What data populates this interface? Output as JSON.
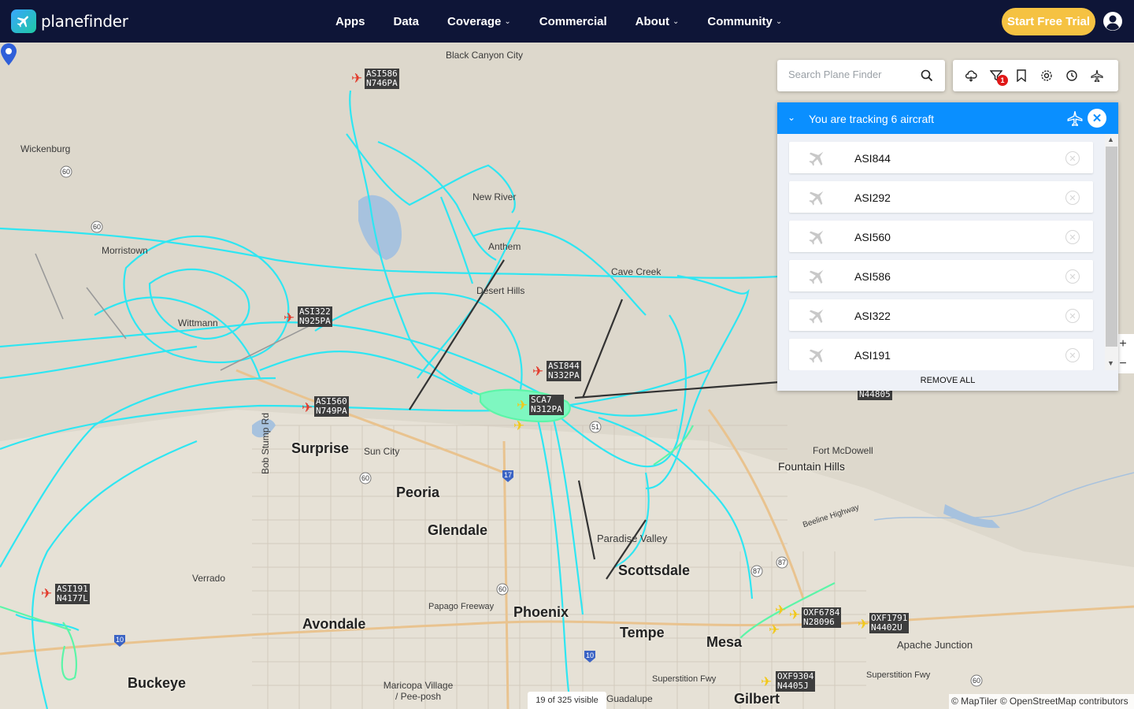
{
  "brand": {
    "name": "planefinder"
  },
  "nav": {
    "items": [
      {
        "label": "Apps",
        "dropdown": false
      },
      {
        "label": "Data",
        "dropdown": false
      },
      {
        "label": "Coverage",
        "dropdown": true
      },
      {
        "label": "Commercial",
        "dropdown": false
      },
      {
        "label": "About",
        "dropdown": true
      },
      {
        "label": "Community",
        "dropdown": true
      }
    ],
    "cta_label": "Start Free Trial"
  },
  "search": {
    "placeholder": "Search Plane Finder"
  },
  "toolbar": {
    "icons": [
      "cloud-icon",
      "filter-icon",
      "bookmark-icon",
      "settings-icon",
      "history-icon",
      "aircraft-settings-icon"
    ],
    "filter_badge": "1"
  },
  "tracking": {
    "title": "You are tracking 6 aircraft",
    "aircraft": [
      "ASI844",
      "ASI292",
      "ASI560",
      "ASI586",
      "ASI322",
      "ASI191"
    ],
    "remove_all_label": "REMOVE ALL"
  },
  "map": {
    "places": [
      "Black Canyon City",
      "Wickenburg",
      "New River",
      "Morristown",
      "Anthem",
      "Desert Hills",
      "Cave Creek",
      "Wittmann",
      "Fort McDowell",
      "Sun City",
      "Bob Stump Rd",
      "Verrado",
      "Papago Freeway",
      "Paradise Valley",
      "Beeline Highway",
      "Superstition Fwy",
      "Superstition Fwy",
      "Apache Junction",
      "Maricopa Village / Pee-posh",
      "Guadalupe"
    ],
    "cities": [
      "Surprise",
      "Peoria",
      "Glendale",
      "Phoenix",
      "Avondale",
      "Tempe",
      "Mesa",
      "Scottsdale",
      "Buckeye",
      "Gilbert",
      "Fountain Hills"
    ],
    "road_shields": [
      "60",
      "60",
      "17",
      "51",
      "60",
      "87",
      "87",
      "10",
      "10",
      "60",
      "60"
    ],
    "aircraft_tags": [
      {
        "callsign": "ASI586",
        "reg": "N746PA"
      },
      {
        "callsign": "ASI322",
        "reg": "N925PA"
      },
      {
        "callsign": "ASI844",
        "reg": "N332PA"
      },
      {
        "callsign": "SCA7",
        "reg": "N312PA"
      },
      {
        "callsign": "ASI560",
        "reg": "N749PA"
      },
      {
        "callsign": "ASI191",
        "reg": "N4177L"
      },
      {
        "callsign": "OXF6784",
        "reg": "N28096"
      },
      {
        "callsign": "OXF1791",
        "reg": "N4402U"
      },
      {
        "callsign": "OXF9304",
        "reg": "N4405J"
      },
      {
        "callsign": "",
        "reg": "N44805"
      }
    ],
    "visible_count": "19 of 325 visible",
    "attribution": "© MapTiler © OpenStreetMap contributors",
    "colors": {
      "track": "#2ee6f2",
      "track_alt": "#5cf5a8",
      "tracked_plane": "#e23a2b",
      "other_plane": "#f2c818"
    }
  }
}
